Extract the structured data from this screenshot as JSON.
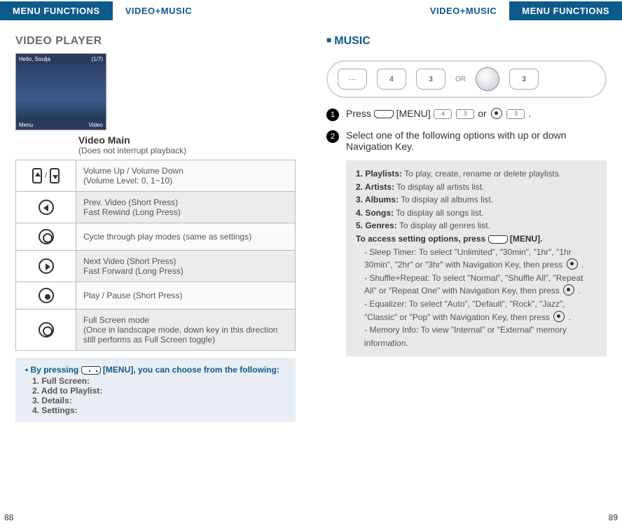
{
  "header": {
    "menu_functions": "MENU FUNCTIONS",
    "video_music": "VIDEO+MUSIC"
  },
  "left": {
    "title": "VIDEO PLAYER",
    "screenshot": {
      "topbar_left": "Hello, Soulja",
      "topbar_right": "(1/7)",
      "bottom_left": "Menu",
      "bottom_right": "Video"
    },
    "video_main_title": "Video Main",
    "video_main_sub": "(Does not interrupt playback)",
    "table": [
      {
        "icon": "volume-keys",
        "text": "Volume Up / Volume Down\n(Volume Level: 0, 1~10)"
      },
      {
        "icon": "prev",
        "text": "Prev. Video (Short Press)\nFast Rewind (Long Press)"
      },
      {
        "icon": "cycle",
        "text": "Cycle through play modes (same as settings)"
      },
      {
        "icon": "next",
        "text": "Next Video (Short Press)\nFast Forward (Long Press)"
      },
      {
        "icon": "playpause",
        "text": "Play / Pause  (Short Press)"
      },
      {
        "icon": "fullscreen",
        "text": "Full Screen mode\n(Once in landscape mode, down key in this direction still performs as Full Screen toggle)"
      }
    ],
    "bluebox": {
      "lead_a": "By pressing ",
      "lead_b": " [MENU], you can choose from the following:",
      "items": [
        "1. Full Screen:",
        "2. Add to Playlist:",
        "3. Details:",
        "4. Settings:"
      ]
    },
    "page": "88"
  },
  "right": {
    "title": "MUSIC",
    "keystrip_or": "OR",
    "steps": {
      "s1_a": "Press ",
      "s1_b": " [MENU] ",
      "s1_c": " or ",
      "s1_d": " .",
      "s2": "Select one of the following options with up or down Navigation Key."
    },
    "graybox": {
      "l1_b": "1. Playlists:",
      "l1_t": " To play, create, rename or delete playlists.",
      "l2_b": "2. Artists:",
      "l2_t": " To display all artists list.",
      "l3_b": "3. Albums:",
      "l3_t": " To display all albums list.",
      "l4_b": "4. Songs:",
      "l4_t": " To display all songs list.",
      "l5_b": "5. Genres:",
      "l5_t": " To display all genres list.",
      "access_b": "To access setting options, press ",
      "access_t": " [MENU].",
      "a1": "- Sleep Timer: To select \"Unlimited\", \"30min\", \"1hr\", \"1hr 30min\", \"2hr\" or \"3hr\" with Navigation Key, then press ",
      "a1end": " .",
      "a2": "- Shuffle+Repeat: To select \"Normal\", \"Shuffle All\", \"Repeat All\" or \"Repeat One\" with  Navigation Key, then press ",
      "a2end": " .",
      "a3": "- Equalizer: To select \"Auto\", \"Default\", \"Rock\", \"Jazz\", \"Classic\" or \"Pop\" with Navigation Key, then press ",
      "a3end": " .",
      "a4": "- Memory Info: To view \"Internal\" or \"External\" memory information."
    },
    "keys": {
      "k4": "4",
      "k3": "3"
    },
    "page": "89"
  }
}
